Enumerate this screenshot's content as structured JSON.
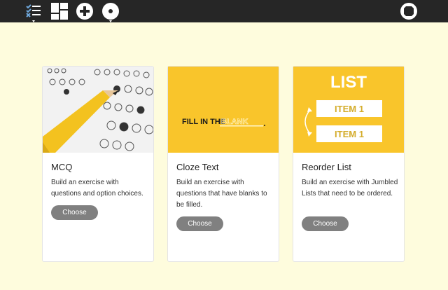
{
  "toolbar": {
    "icons": [
      "checklist-icon",
      "dashboard-icon",
      "add-icon",
      "record-icon",
      "stop-icon"
    ]
  },
  "colors": {
    "topbar": "#262626",
    "background": "#fefcdd",
    "card_yellow": "#f9c52b",
    "button": "#808080"
  },
  "cards": [
    {
      "title": "MCQ",
      "description": "Build an exercise with questions and option choices.",
      "button": "Choose",
      "image": "answer-sheet-with-pencil"
    },
    {
      "title": "Cloze Text",
      "description": "Build an exercise with questions that have blanks to be filled.",
      "button": "Choose",
      "image": "fill-in-the-blank",
      "image_text": "FILL IN THE",
      "image_blank_text": "BLANK"
    },
    {
      "title": "Reorder List",
      "description": "Build an exercise with Jumbled Lists that need to be ordered.",
      "button": "Choose",
      "image": "list-reorder",
      "image_title": "LIST",
      "image_items": [
        "ITEM 1",
        "ITEM 1"
      ]
    }
  ]
}
